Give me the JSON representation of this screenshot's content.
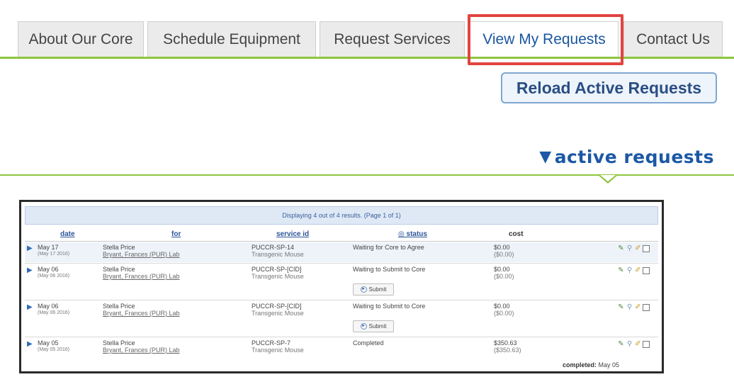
{
  "tabs": [
    {
      "label": "About Our Core"
    },
    {
      "label": "Schedule Equipment"
    },
    {
      "label": "Request Services"
    },
    {
      "label": "View My Requests"
    },
    {
      "label": "Contact Us"
    }
  ],
  "reload_button": {
    "label": "Reload Active Requests"
  },
  "section": {
    "title": "active requests",
    "icon": "triangle-down-icon"
  },
  "panel": {
    "banner": "Displaying 4 out of 4 results. (Page 1 of 1)",
    "headers": {
      "date": "date",
      "for": "for",
      "service_id": "service id",
      "status": "status",
      "cost": "cost"
    },
    "rows": [
      {
        "date": "May 17",
        "date_full": "(May 17 2016)",
        "name": "Stella Price",
        "lab": "Bryant, Frances (PUR) Lab",
        "service_id": "PUCCR-SP-14",
        "service_type": "Transgenic Mouse",
        "status": "Waiting for Core to Agree",
        "cost": "$0.00",
        "cost_sub": "($0.00)"
      },
      {
        "date": "May 06",
        "date_full": "(May 06 2016)",
        "name": "Stella Price",
        "lab": "Bryant, Frances (PUR) Lab",
        "service_id": "PUCCR-SP-[CID]",
        "service_type": "Transgenic Mouse",
        "status": "Waiting to Submit to Core",
        "cost": "$0.00",
        "cost_sub": "($0.00)",
        "submit": "Submit"
      },
      {
        "date": "May 06",
        "date_full": "(May 06 2016)",
        "name": "Stella Price",
        "lab": "Bryant, Frances (PUR) Lab",
        "service_id": "PUCCR-SP-[CID]",
        "service_type": "Transgenic Mouse",
        "status": "Waiting to Submit to Core",
        "cost": "$0.00",
        "cost_sub": "($0.00)",
        "submit": "Submit"
      },
      {
        "date": "May 05",
        "date_full": "(May 05 2016)",
        "name": "Stella Price",
        "lab": "Bryant, Frances (PUR) Lab",
        "service_id": "PUCCR-SP-7",
        "service_type": "Transgenic Mouse",
        "status": "Completed",
        "cost": "$350.63",
        "cost_sub": "($350.63)"
      }
    ],
    "footer": {
      "label": "completed",
      "value": "May 05"
    }
  },
  "colors": {
    "accent_green": "#8dc63f",
    "link_blue": "#1c58a5",
    "highlight_red": "#e2443f"
  }
}
